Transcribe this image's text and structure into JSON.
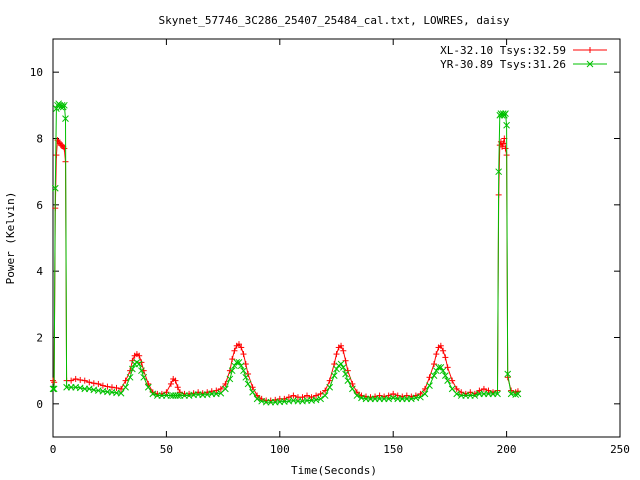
{
  "chart_data": {
    "type": "scatter",
    "title": "Skynet_57746_3C286_25407_25484_cal.txt, LOWRES, daisy",
    "xlabel": "Time(Seconds)",
    "ylabel": "Power (Kelvin)",
    "xlim": [
      0,
      250
    ],
    "ylim": [
      -1,
      11
    ],
    "xticks": [
      0,
      50,
      100,
      150,
      200,
      250
    ],
    "yticks": [
      0,
      2,
      4,
      6,
      8,
      10
    ],
    "legend_position": "top-right",
    "grid": false,
    "series": [
      {
        "name": "XL-32.10 Tsys:32.59",
        "color": "#ff0000",
        "marker": "plus",
        "points": [
          [
            0,
            0.7
          ],
          [
            0.5,
            0.65
          ],
          [
            1,
            5.9
          ],
          [
            1.5,
            7.5
          ],
          [
            2,
            7.95
          ],
          [
            2.5,
            7.9
          ],
          [
            3,
            7.85
          ],
          [
            3.5,
            7.8
          ],
          [
            4,
            7.8
          ],
          [
            4.5,
            7.75
          ],
          [
            5,
            7.7
          ],
          [
            5.5,
            7.3
          ],
          [
            6,
            0.7
          ],
          [
            8,
            0.7
          ],
          [
            10,
            0.75
          ],
          [
            12,
            0.72
          ],
          [
            14,
            0.7
          ],
          [
            16,
            0.65
          ],
          [
            18,
            0.62
          ],
          [
            20,
            0.6
          ],
          [
            22,
            0.55
          ],
          [
            24,
            0.52
          ],
          [
            26,
            0.5
          ],
          [
            28,
            0.48
          ],
          [
            30,
            0.45
          ],
          [
            32,
            0.7
          ],
          [
            34,
            1.0
          ],
          [
            35,
            1.3
          ],
          [
            36,
            1.45
          ],
          [
            37,
            1.5
          ],
          [
            38,
            1.45
          ],
          [
            39,
            1.25
          ],
          [
            40,
            1.0
          ],
          [
            42,
            0.6
          ],
          [
            44,
            0.35
          ],
          [
            46,
            0.3
          ],
          [
            48,
            0.3
          ],
          [
            50,
            0.35
          ],
          [
            52,
            0.6
          ],
          [
            53,
            0.75
          ],
          [
            54,
            0.7
          ],
          [
            55,
            0.5
          ],
          [
            56,
            0.35
          ],
          [
            58,
            0.3
          ],
          [
            60,
            0.3
          ],
          [
            62,
            0.32
          ],
          [
            64,
            0.35
          ],
          [
            66,
            0.32
          ],
          [
            68,
            0.35
          ],
          [
            70,
            0.38
          ],
          [
            72,
            0.4
          ],
          [
            74,
            0.45
          ],
          [
            76,
            0.6
          ],
          [
            78,
            1.0
          ],
          [
            79,
            1.35
          ],
          [
            80,
            1.6
          ],
          [
            81,
            1.75
          ],
          [
            82,
            1.8
          ],
          [
            83,
            1.7
          ],
          [
            84,
            1.5
          ],
          [
            85,
            1.2
          ],
          [
            86,
            0.9
          ],
          [
            88,
            0.5
          ],
          [
            90,
            0.25
          ],
          [
            92,
            0.15
          ],
          [
            94,
            0.1
          ],
          [
            96,
            0.1
          ],
          [
            98,
            0.12
          ],
          [
            100,
            0.15
          ],
          [
            102,
            0.15
          ],
          [
            104,
            0.2
          ],
          [
            106,
            0.25
          ],
          [
            108,
            0.2
          ],
          [
            110,
            0.2
          ],
          [
            112,
            0.25
          ],
          [
            114,
            0.2
          ],
          [
            116,
            0.25
          ],
          [
            118,
            0.3
          ],
          [
            120,
            0.4
          ],
          [
            122,
            0.7
          ],
          [
            124,
            1.2
          ],
          [
            125,
            1.5
          ],
          [
            126,
            1.7
          ],
          [
            127,
            1.75
          ],
          [
            128,
            1.6
          ],
          [
            129,
            1.3
          ],
          [
            130,
            1.0
          ],
          [
            132,
            0.6
          ],
          [
            134,
            0.35
          ],
          [
            136,
            0.25
          ],
          [
            138,
            0.22
          ],
          [
            140,
            0.2
          ],
          [
            142,
            0.22
          ],
          [
            144,
            0.25
          ],
          [
            146,
            0.22
          ],
          [
            148,
            0.25
          ],
          [
            150,
            0.3
          ],
          [
            152,
            0.25
          ],
          [
            154,
            0.22
          ],
          [
            156,
            0.25
          ],
          [
            158,
            0.22
          ],
          [
            160,
            0.25
          ],
          [
            162,
            0.3
          ],
          [
            164,
            0.45
          ],
          [
            166,
            0.8
          ],
          [
            168,
            1.2
          ],
          [
            169,
            1.5
          ],
          [
            170,
            1.7
          ],
          [
            171,
            1.75
          ],
          [
            172,
            1.6
          ],
          [
            173,
            1.4
          ],
          [
            174,
            1.1
          ],
          [
            176,
            0.7
          ],
          [
            178,
            0.45
          ],
          [
            180,
            0.35
          ],
          [
            182,
            0.3
          ],
          [
            184,
            0.35
          ],
          [
            186,
            0.3
          ],
          [
            188,
            0.4
          ],
          [
            190,
            0.45
          ],
          [
            192,
            0.4
          ],
          [
            194,
            0.35
          ],
          [
            196,
            0.4
          ],
          [
            196.5,
            6.3
          ],
          [
            197,
            7.8
          ],
          [
            197.5,
            7.9
          ],
          [
            198,
            7.75
          ],
          [
            198.5,
            7.85
          ],
          [
            199,
            8.0
          ],
          [
            199.5,
            7.7
          ],
          [
            200,
            7.5
          ],
          [
            200.5,
            0.8
          ],
          [
            202,
            0.4
          ],
          [
            204,
            0.35
          ],
          [
            205,
            0.38
          ]
        ]
      },
      {
        "name": "YR-30.89 Tsys:31.26",
        "color": "#00c000",
        "marker": "cross",
        "points": [
          [
            0,
            0.45
          ],
          [
            0.5,
            0.45
          ],
          [
            1,
            6.5
          ],
          [
            1.5,
            8.9
          ],
          [
            2,
            9.0
          ],
          [
            2.5,
            9.05
          ],
          [
            3,
            9.0
          ],
          [
            3.5,
            8.95
          ],
          [
            4,
            9.0
          ],
          [
            4.5,
            8.95
          ],
          [
            5,
            9.0
          ],
          [
            5.5,
            8.6
          ],
          [
            6,
            0.5
          ],
          [
            8,
            0.5
          ],
          [
            10,
            0.5
          ],
          [
            12,
            0.48
          ],
          [
            14,
            0.45
          ],
          [
            16,
            0.45
          ],
          [
            18,
            0.42
          ],
          [
            20,
            0.4
          ],
          [
            22,
            0.38
          ],
          [
            24,
            0.36
          ],
          [
            26,
            0.35
          ],
          [
            28,
            0.33
          ],
          [
            30,
            0.32
          ],
          [
            32,
            0.5
          ],
          [
            34,
            0.8
          ],
          [
            35,
            1.05
          ],
          [
            36,
            1.2
          ],
          [
            37,
            1.25
          ],
          [
            38,
            1.2
          ],
          [
            39,
            1.0
          ],
          [
            40,
            0.8
          ],
          [
            42,
            0.5
          ],
          [
            44,
            0.3
          ],
          [
            46,
            0.25
          ],
          [
            48,
            0.25
          ],
          [
            50,
            0.25
          ],
          [
            52,
            0.25
          ],
          [
            53,
            0.25
          ],
          [
            54,
            0.25
          ],
          [
            55,
            0.25
          ],
          [
            56,
            0.25
          ],
          [
            58,
            0.25
          ],
          [
            60,
            0.25
          ],
          [
            62,
            0.27
          ],
          [
            64,
            0.28
          ],
          [
            66,
            0.27
          ],
          [
            68,
            0.28
          ],
          [
            70,
            0.3
          ],
          [
            72,
            0.3
          ],
          [
            74,
            0.32
          ],
          [
            76,
            0.45
          ],
          [
            78,
            0.75
          ],
          [
            79,
            1.0
          ],
          [
            80,
            1.15
          ],
          [
            81,
            1.25
          ],
          [
            82,
            1.25
          ],
          [
            83,
            1.15
          ],
          [
            84,
            1.0
          ],
          [
            85,
            0.8
          ],
          [
            86,
            0.6
          ],
          [
            88,
            0.35
          ],
          [
            90,
            0.15
          ],
          [
            92,
            0.08
          ],
          [
            94,
            0.05
          ],
          [
            96,
            0.05
          ],
          [
            98,
            0.05
          ],
          [
            100,
            0.06
          ],
          [
            102,
            0.07
          ],
          [
            104,
            0.08
          ],
          [
            106,
            0.1
          ],
          [
            108,
            0.08
          ],
          [
            110,
            0.08
          ],
          [
            112,
            0.1
          ],
          [
            114,
            0.1
          ],
          [
            116,
            0.12
          ],
          [
            118,
            0.15
          ],
          [
            120,
            0.25
          ],
          [
            122,
            0.5
          ],
          [
            124,
            0.85
          ],
          [
            125,
            1.05
          ],
          [
            126,
            1.15
          ],
          [
            127,
            1.2
          ],
          [
            128,
            1.1
          ],
          [
            129,
            0.9
          ],
          [
            130,
            0.7
          ],
          [
            132,
            0.45
          ],
          [
            134,
            0.25
          ],
          [
            136,
            0.18
          ],
          [
            138,
            0.15
          ],
          [
            140,
            0.15
          ],
          [
            142,
            0.15
          ],
          [
            144,
            0.15
          ],
          [
            146,
            0.15
          ],
          [
            148,
            0.15
          ],
          [
            150,
            0.18
          ],
          [
            152,
            0.15
          ],
          [
            154,
            0.15
          ],
          [
            156,
            0.15
          ],
          [
            158,
            0.15
          ],
          [
            160,
            0.18
          ],
          [
            162,
            0.2
          ],
          [
            164,
            0.3
          ],
          [
            166,
            0.55
          ],
          [
            168,
            0.85
          ],
          [
            169,
            1.0
          ],
          [
            170,
            1.1
          ],
          [
            171,
            1.1
          ],
          [
            172,
            1.0
          ],
          [
            173,
            0.85
          ],
          [
            174,
            0.7
          ],
          [
            176,
            0.45
          ],
          [
            178,
            0.3
          ],
          [
            180,
            0.25
          ],
          [
            182,
            0.25
          ],
          [
            184,
            0.25
          ],
          [
            186,
            0.25
          ],
          [
            188,
            0.3
          ],
          [
            190,
            0.3
          ],
          [
            192,
            0.3
          ],
          [
            194,
            0.3
          ],
          [
            196,
            0.3
          ],
          [
            196.5,
            7.0
          ],
          [
            197,
            8.7
          ],
          [
            197.5,
            8.75
          ],
          [
            198,
            8.7
          ],
          [
            198.5,
            8.75
          ],
          [
            199,
            8.7
          ],
          [
            199.5,
            8.75
          ],
          [
            200,
            8.4
          ],
          [
            200.5,
            0.9
          ],
          [
            202,
            0.3
          ],
          [
            204,
            0.28
          ],
          [
            205,
            0.3
          ]
        ]
      }
    ]
  }
}
